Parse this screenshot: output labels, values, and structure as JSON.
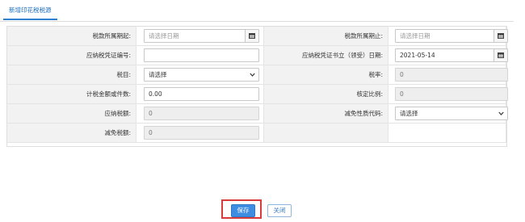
{
  "tab": {
    "label": "新增印花税税源"
  },
  "form": {
    "period_start": {
      "label": "税款所属期起:",
      "placeholder": "请选择日期"
    },
    "period_end": {
      "label": "税款所属期止:",
      "placeholder": "请选择日期"
    },
    "voucher_no": {
      "label": "应纳税凭证编号:",
      "value": ""
    },
    "voucher_date": {
      "label": "应纳税凭证书立（领受）日期:",
      "value": "2021-05-14"
    },
    "tax_item": {
      "label": "税目:",
      "value": "请选择"
    },
    "tax_rate": {
      "label": "税率:",
      "value": "0"
    },
    "tax_base": {
      "label": "计税金额或件数:",
      "value": "0.00"
    },
    "approved_ratio": {
      "label": "核定比例:",
      "value": "0"
    },
    "tax_payable": {
      "label": "应纳税额:",
      "value": "0"
    },
    "exemption_code": {
      "label": "减免性质代码:",
      "value": "请选择"
    },
    "tax_reduction": {
      "label": "减免税额:",
      "value": "0"
    }
  },
  "buttons": {
    "save": "保存",
    "close": "关闭"
  },
  "colors": {
    "accent": "#3f8de0",
    "highlight": "#d93a3a"
  }
}
